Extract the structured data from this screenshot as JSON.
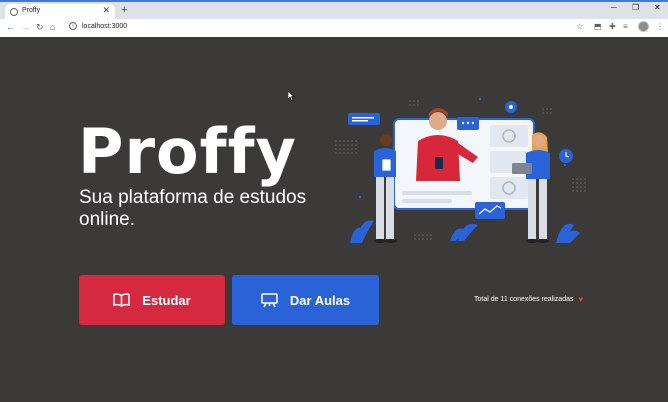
{
  "browser": {
    "tab_title": "Proffy",
    "tab_close": "✕",
    "new_tab": "+",
    "url": "localhost:3000",
    "info_glyph": "i"
  },
  "page": {
    "logo": "Proffy",
    "tagline": "Sua plataforma de estudos online.",
    "study_button": "Estudar",
    "teach_button": "Dar Aulas",
    "total_connections": "Total de 11 conexões realizadas",
    "heart": "♥"
  },
  "colors": {
    "background": "#3c3939",
    "study": "#d5293f",
    "teach": "#2a63d8",
    "illustration_accent": "#2a63d8",
    "tab_accent": "#3c7bd8"
  },
  "icons": [
    "globe-icon",
    "back-icon",
    "forward-icon",
    "reload-icon",
    "home-icon",
    "star-icon",
    "extension-icon",
    "puzzle-icon",
    "playlist-icon",
    "menu-icon",
    "book-icon",
    "presentation-icon",
    "heart-icon"
  ]
}
